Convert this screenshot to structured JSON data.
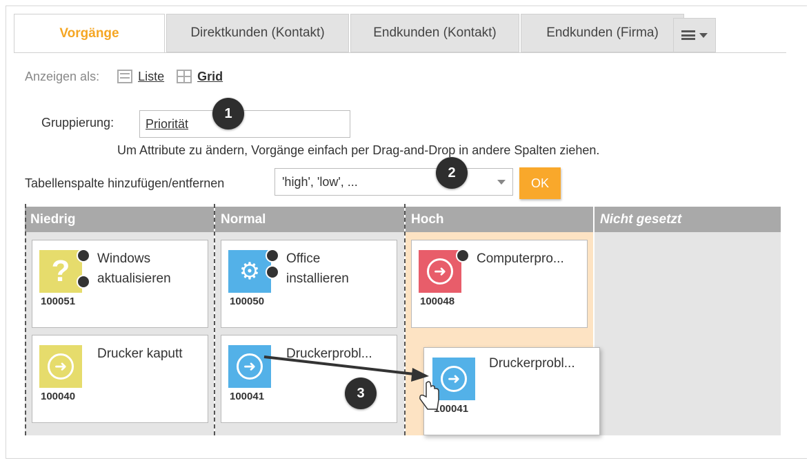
{
  "tabs": [
    {
      "label": "Vorgänge",
      "active": true
    },
    {
      "label": "Direktkunden (Kontakt)",
      "active": false
    },
    {
      "label": "Endkunden (Kontakt)",
      "active": false
    },
    {
      "label": "Endkunden (Firma)",
      "active": false
    }
  ],
  "tab_menu_icon": "list-menu-icon",
  "view": {
    "label": "Anzeigen als:",
    "list_label": "Liste",
    "grid_label": "Grid",
    "selected": "Grid"
  },
  "grouping": {
    "label": "Gruppierung:",
    "value": "Priorität"
  },
  "hint": "Um Attribute zu ändern, Vorgänge einfach per Drag-and-Drop in andere Spalten ziehen.",
  "columns_selector": {
    "label": "Tabellenspalte hinzufügen/entfernen",
    "value": "'high', 'low',  ...",
    "ok_label": "OK"
  },
  "board": {
    "columns": [
      {
        "title": "Niedrig"
      },
      {
        "title": "Normal"
      },
      {
        "title": "Hoch"
      },
      {
        "title": "Nicht gesetzt"
      }
    ],
    "cards": [
      {
        "column": "Niedrig",
        "title_line1": "Windows",
        "title_line2": "aktualisieren",
        "number": "100051",
        "icon": "question-icon",
        "color": "#e6dc6c"
      },
      {
        "column": "Niedrig",
        "title_line1": "Drucker kaputt",
        "title_line2": "",
        "number": "100040",
        "icon": "arrow-circle-icon",
        "color": "#e6dc6c"
      },
      {
        "column": "Normal",
        "title_line1": "Office",
        "title_line2": "installieren",
        "number": "100050",
        "icon": "gears-icon",
        "color": "#53b1e8"
      },
      {
        "column": "Normal",
        "title_line1": "Druckerprobl...",
        "title_line2": "",
        "number": "100041",
        "icon": "arrow-circle-icon",
        "color": "#53b1e8"
      },
      {
        "column": "Hoch",
        "title_line1": "Computerpro...",
        "title_line2": "",
        "number": "100048",
        "icon": "arrow-circle-icon",
        "color": "#e85d6a"
      }
    ],
    "dragging_card": {
      "title": "Druckerprobl...",
      "number": "100041",
      "icon": "arrow-circle-icon",
      "color": "#53b1e8"
    }
  },
  "markers": [
    "1",
    "2",
    "3"
  ]
}
